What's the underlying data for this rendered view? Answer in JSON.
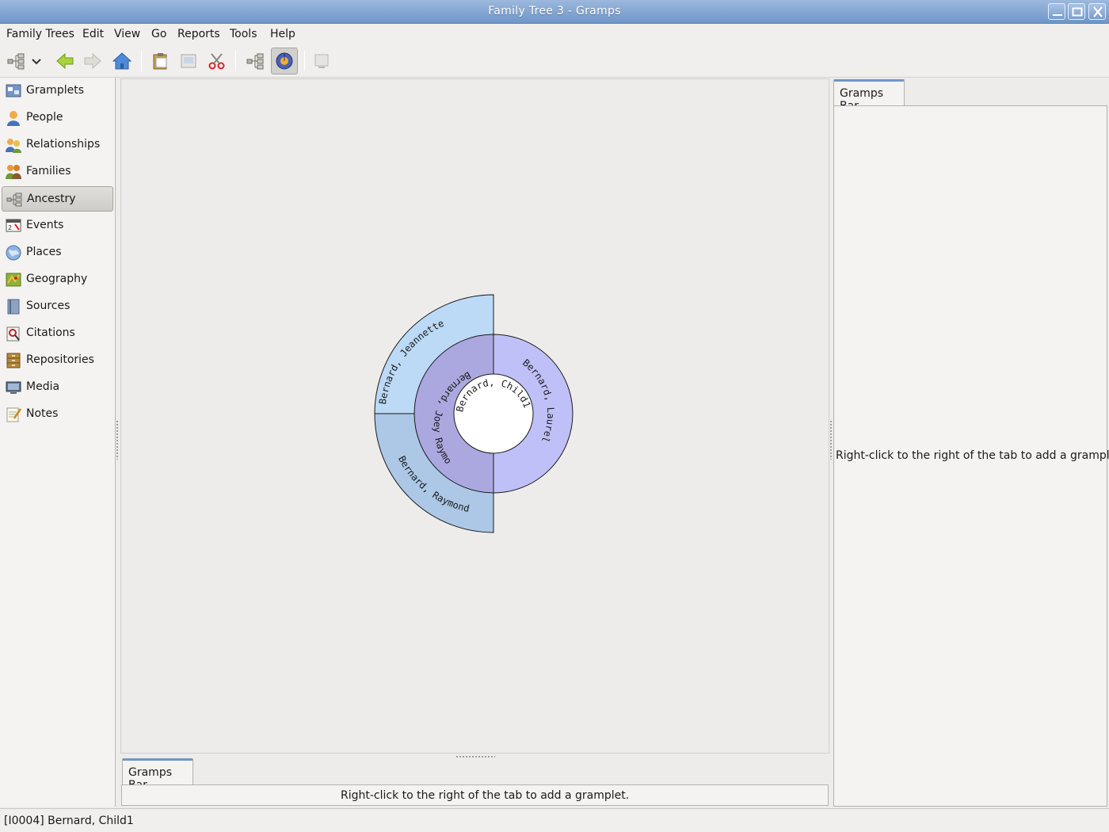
{
  "window": {
    "title": "Family Tree 3 - Gramps",
    "controls": [
      "minimize-icon",
      "maximize-icon",
      "close-icon"
    ]
  },
  "menubar": {
    "items": [
      {
        "label": "Family Trees"
      },
      {
        "label": "Edit"
      },
      {
        "label": "View"
      },
      {
        "label": "Go"
      },
      {
        "label": "Reports"
      },
      {
        "label": "Tools"
      },
      {
        "label": "Help"
      }
    ]
  },
  "toolbar": {
    "buttons": [
      {
        "icon": "family-tree-icon"
      },
      {
        "icon": "chevron-down-icon"
      },
      {
        "icon": "back-arrow-icon"
      },
      {
        "icon": "forward-arrow-icon"
      },
      {
        "icon": "home-icon"
      },
      {
        "icon": "clipboard-icon"
      },
      {
        "icon": "image-icon"
      },
      {
        "icon": "scissors-icon"
      },
      {
        "icon": "pedigree-view-icon"
      },
      {
        "icon": "fan-chart-view-icon",
        "active": true
      },
      {
        "icon": "config-view-icon"
      }
    ]
  },
  "navigator": {
    "items": [
      {
        "label": "Gramplets",
        "icon": "gramplets-icon"
      },
      {
        "label": "People",
        "icon": "person-icon"
      },
      {
        "label": "Relationships",
        "icon": "relationships-icon"
      },
      {
        "label": "Families",
        "icon": "family-icon"
      },
      {
        "label": "Ancestry",
        "icon": "ancestry-icon",
        "selected": true
      },
      {
        "label": "Events",
        "icon": "calendar-icon"
      },
      {
        "label": "Places",
        "icon": "globe-icon"
      },
      {
        "label": "Geography",
        "icon": "map-icon"
      },
      {
        "label": "Sources",
        "icon": "book-icon"
      },
      {
        "label": "Citations",
        "icon": "citation-icon"
      },
      {
        "label": "Repositories",
        "icon": "repository-icon"
      },
      {
        "label": "Media",
        "icon": "media-icon"
      },
      {
        "label": "Notes",
        "icon": "notes-icon"
      }
    ]
  },
  "fan_chart": {
    "center": {
      "name": "Bernard, Child1",
      "color": "#ffffff"
    },
    "generation_1": [
      {
        "name": "Bernard, Joey Raymond",
        "side": "paternal",
        "color": "#aba8e0"
      },
      {
        "name": "Bernard, Laurel",
        "side": "maternal",
        "color": "#c0c0f8"
      }
    ],
    "generation_2": [
      {
        "name": "Bernard, Jeannette",
        "color": "#bcdaf6"
      },
      {
        "name": "Bernard, Raymond",
        "color": "#acc8e6"
      }
    ]
  },
  "bottom_bar": {
    "tab_label": "Gramps Bar",
    "hint": "Right-click to the right of the tab to add a gramplet."
  },
  "side_bar": {
    "tab_label": "Gramps Bar",
    "hint": "Right-click to the right of the tab to add a gramplet."
  },
  "statusbar": {
    "text": "[I0004] Bernard, Child1"
  },
  "colors": {
    "titlebar": "#7fa2d3",
    "selected_nav": "#d6d4d0",
    "tab_accent": "#6f95c8"
  }
}
